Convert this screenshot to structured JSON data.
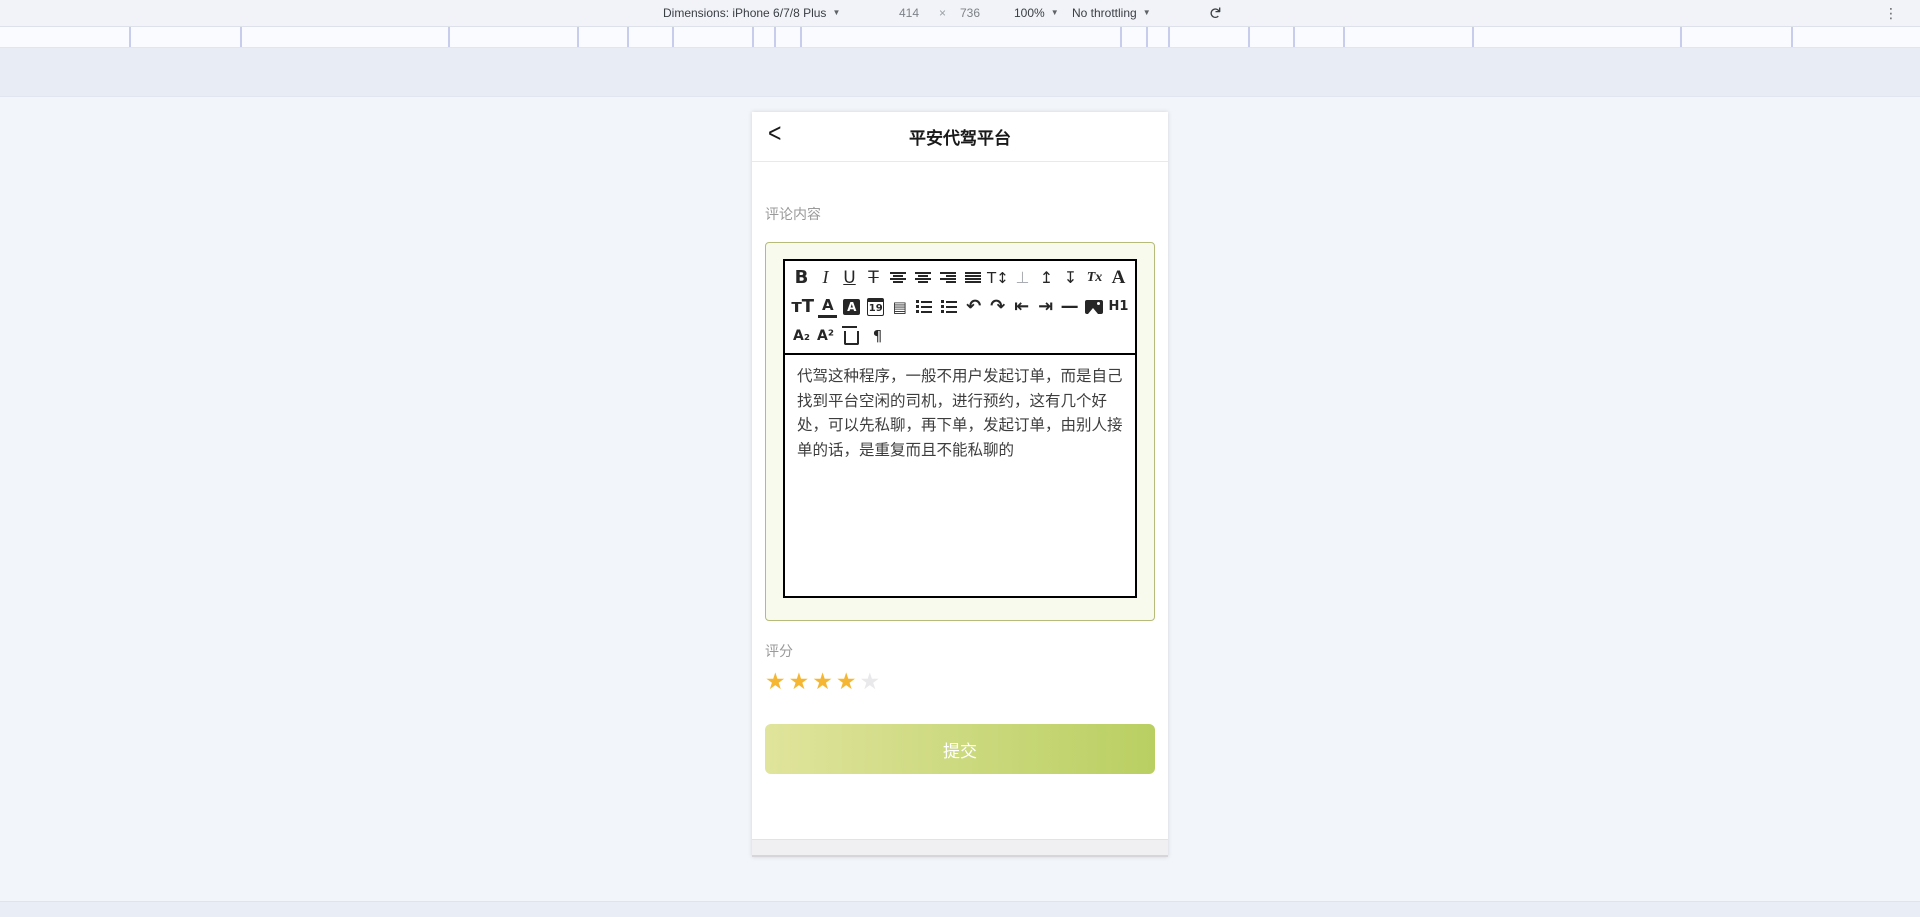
{
  "devtools": {
    "dimensions_label": "Dimensions: iPhone 6/7/8 Plus",
    "width_value": "414",
    "multiply_sign": "×",
    "height_value": "736",
    "zoom_value": "100%",
    "throttling_value": "No throttling",
    "caret_glyph": "▼",
    "rotate_glyph": "↻",
    "menu_glyph": "⋮",
    "ruler_ticks": [
      129,
      240,
      448,
      577,
      627,
      672,
      752,
      774,
      800,
      1120,
      1146,
      1168,
      1248,
      1293,
      1343,
      1472,
      1680,
      1791
    ]
  },
  "app": {
    "header": {
      "back_glyph": "<",
      "title": "平安代驾平台"
    },
    "comment": {
      "label": "评论内容",
      "content": "代驾这种程序，一般不用户发起订单，而是自己找到平台空闲的司机，进行预约，这有几个好处，可以先私聊，再下单，发起订单，由别人接单的话，是重复而且不能私聊的",
      "toolbar_rows": [
        [
          {
            "name": "bold-icon",
            "glyph": "B",
            "cls": "b"
          },
          {
            "name": "italic-icon",
            "glyph": "I",
            "cls": "it"
          },
          {
            "name": "underline-icon",
            "glyph": "U",
            "cls": "ul"
          },
          {
            "name": "strikethrough-icon",
            "glyph": "T",
            "cls": "st"
          },
          {
            "name": "align-left-icon",
            "cls": "bars align-l",
            "bars": 4
          },
          {
            "name": "align-center-icon",
            "cls": "bars align-c",
            "bars": 4
          },
          {
            "name": "align-right-icon",
            "cls": "bars align-r",
            "bars": 4
          },
          {
            "name": "align-justify-icon",
            "cls": "bars align-j",
            "bars": 4
          },
          {
            "name": "text-height-icon",
            "glyph": "T↕",
            "cls": "sm"
          },
          {
            "name": "vertical-align-icon",
            "glyph": "⊥",
            "cls": "mut"
          },
          {
            "name": "spacing-before-icon",
            "glyph": "↥",
            "cls": "sp"
          },
          {
            "name": "spacing-after-icon",
            "glyph": "↧",
            "cls": "sp"
          },
          {
            "name": "clear-format-icon",
            "glyph": "Tx",
            "cls": "tx"
          },
          {
            "name": "font-family-icon",
            "glyph": "A",
            "cls": "ser"
          }
        ],
        [
          {
            "name": "font-size-icon",
            "glyph": "ᴛT",
            "cls": "b"
          },
          {
            "name": "font-color-icon",
            "glyph": "A",
            "cls": "fc"
          },
          {
            "name": "background-color-icon",
            "glyph": "A",
            "cls": "abox"
          },
          {
            "name": "date-icon",
            "glyph": "19",
            "cls": "cal"
          },
          {
            "name": "clipboard-icon",
            "glyph": "▤",
            "cls": "sm"
          },
          {
            "name": "ordered-list-icon",
            "cls": "listic ol",
            "bars": 3
          },
          {
            "name": "unordered-list-icon",
            "cls": "listic ul2",
            "bars": 3
          },
          {
            "name": "undo-icon",
            "glyph": "↶",
            "cls": "b"
          },
          {
            "name": "redo-icon",
            "glyph": "↷",
            "cls": "b"
          },
          {
            "name": "outdent-icon",
            "glyph": "⇤",
            "cls": "b"
          },
          {
            "name": "indent-icon",
            "glyph": "⇥",
            "cls": "b"
          },
          {
            "name": "horizontal-rule-icon",
            "glyph": "—",
            "cls": "b"
          },
          {
            "name": "image-icon",
            "cls": "imgic"
          },
          {
            "name": "h1-icon",
            "glyph": "H1",
            "cls": "h1"
          }
        ],
        [
          {
            "name": "subscript-icon",
            "glyph": "A₂",
            "cls": "scr"
          },
          {
            "name": "superscript-icon",
            "glyph": "A²",
            "cls": "scr"
          },
          {
            "name": "trash-icon",
            "cls": "trashic"
          },
          {
            "name": "paragraph-icon",
            "glyph": "¶",
            "cls": "sm"
          }
        ]
      ]
    },
    "rating": {
      "label": "评分",
      "stars_total": 5,
      "stars_filled": 4,
      "star_glyph": "★",
      "star_filled_color": "#f5b733",
      "star_empty_color": "#e9e9ec"
    },
    "submit": {
      "label": "提交",
      "gradient_start": "#e0e49c",
      "gradient_end": "#b9cf62"
    },
    "colors": {
      "editor_wrapper_border": "#b6bb79",
      "editor_wrapper_bg": "#f8faee",
      "editor_border": "#000000",
      "label_gray": "#9a9a9a"
    }
  }
}
